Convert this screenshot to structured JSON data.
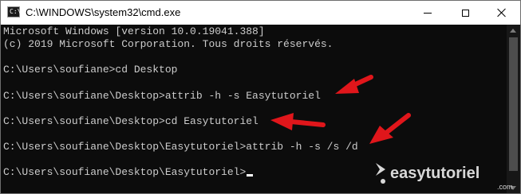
{
  "window": {
    "title": "C:\\WINDOWS\\system32\\cmd.exe",
    "icon": "cmd-icon",
    "controls": [
      "minimize-icon",
      "maximize-icon",
      "close-icon"
    ]
  },
  "console": {
    "lines": [
      "Microsoft Windows [version 10.0.19041.388]",
      "(c) 2019 Microsoft Corporation. Tous droits réservés.",
      "",
      "C:\\Users\\soufiane>cd Desktop",
      "",
      "C:\\Users\\soufiane\\Desktop>attrib -h -s Easytutoriel",
      "",
      "C:\\Users\\soufiane\\Desktop>cd Easytutoriel",
      "",
      "C:\\Users\\soufiane\\Desktop\\Easytutoriel>attrib -h -s /s /d",
      "",
      "C:\\Users\\soufiane\\Desktop\\Easytutoriel>"
    ],
    "text_color": "#cccccc",
    "background": "#0c0c0c"
  },
  "watermark": {
    "brand": "easytutoriel",
    "domain": ".com",
    "color": "#d8d8d8"
  },
  "annotations": {
    "arrow_color": "#e0161b"
  }
}
